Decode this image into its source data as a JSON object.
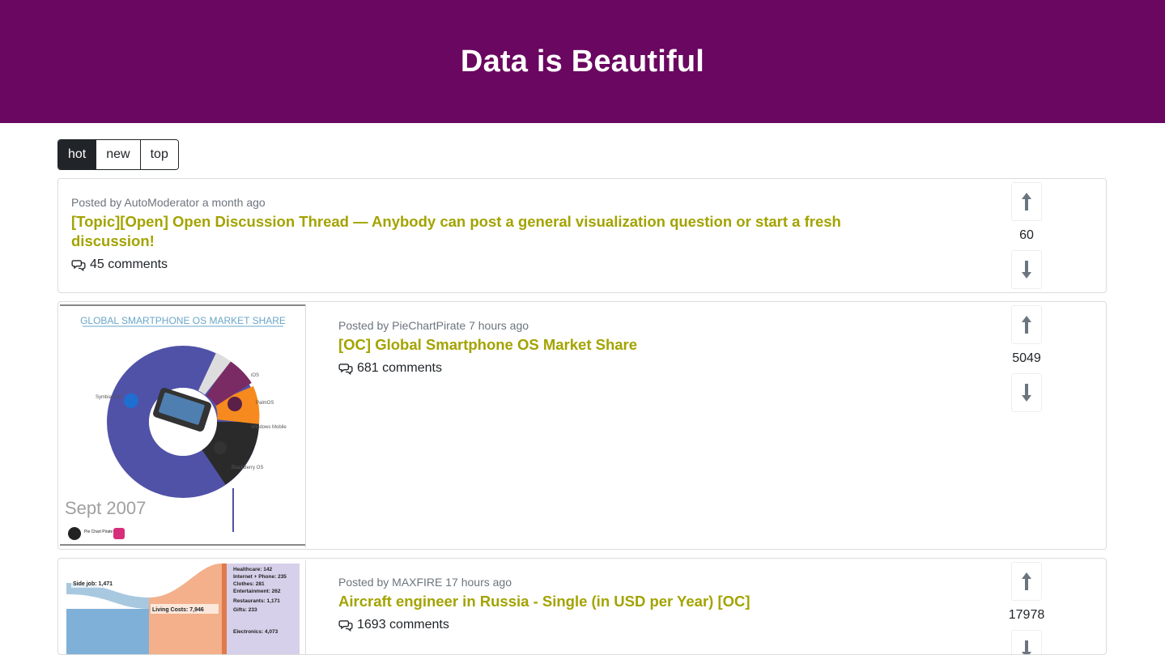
{
  "header": {
    "title": "Data is Beautiful"
  },
  "sort": {
    "hot": "hot",
    "new": "new",
    "top": "top",
    "active": "hot"
  },
  "posts": [
    {
      "meta": "Posted by AutoModerator a month ago",
      "title": "[Topic][Open] Open Discussion Thread — Anybody can post a general visualization question or start a fresh discussion!",
      "comments": "45 comments",
      "score": "60"
    },
    {
      "meta": "Posted by PieChartPirate 7 hours ago",
      "title": "[OC] Global Smartphone OS Market Share",
      "comments": "681 comments",
      "score": "5049",
      "thumb": {
        "heading": "GLOBAL SMARTPHONE OS MARKET SHARE",
        "date": "Sept 2007",
        "labels": [
          "SymbianOS",
          "iOS",
          "PalmOS",
          "Windows Mobile",
          "BlackBerry OS"
        ],
        "brand": "Pie Chart Pirate"
      }
    },
    {
      "meta": "Posted by MAXFIRE 17 hours ago",
      "title": "Aircraft engineer in Russia - Single (in USD per Year) [OC]",
      "comments": "1693 comments",
      "score": "17978",
      "thumb": {
        "side_job": "Side job: 1,471",
        "living_costs": "Living Costs: 7,946",
        "items": [
          "Healthcare: 142",
          "Internet + Phone: 235",
          "Clothes: 281",
          "Entertainment: 262",
          "Restaurants: 1,171",
          "Gifts: 233",
          "Electronics: 4,073"
        ]
      }
    }
  ]
}
